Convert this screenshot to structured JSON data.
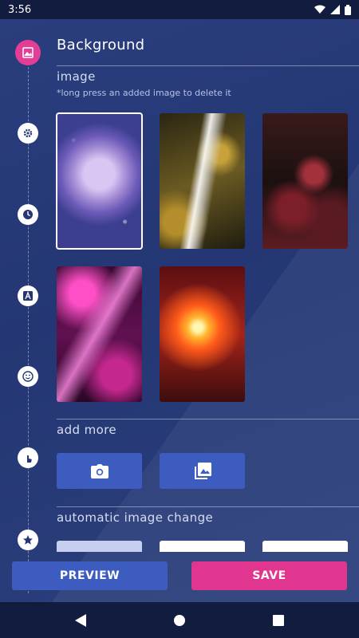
{
  "status_bar": {
    "time": "3:56",
    "icons": [
      "wifi-icon",
      "signal-icon",
      "battery-icon"
    ]
  },
  "header": {
    "title": "Background"
  },
  "image_section": {
    "label": "image",
    "hint": "*long press an added image to delete it",
    "thumbnails": [
      {
        "name": "rose",
        "selected": true
      },
      {
        "name": "feather",
        "selected": false
      },
      {
        "name": "roses",
        "selected": false
      },
      {
        "name": "pink-nebula",
        "selected": false
      },
      {
        "name": "fire-burst",
        "selected": false
      }
    ]
  },
  "add_more": {
    "label": "add more",
    "buttons": [
      "camera-icon",
      "gallery-icon"
    ]
  },
  "auto_change": {
    "label": "automatic image change"
  },
  "timeline_icons": [
    "image-icon",
    "gear-icon",
    "clock-icon",
    "text-icon",
    "emoji-icon",
    "touch-icon",
    "star-icon"
  ],
  "actions": {
    "preview": "PREVIEW",
    "save": "SAVE"
  },
  "colors": {
    "accent": "#e0368f",
    "primary": "#3c5cc0",
    "background": "#243774"
  },
  "navbar": {
    "icons": [
      "back-icon",
      "home-icon",
      "recents-icon"
    ]
  }
}
